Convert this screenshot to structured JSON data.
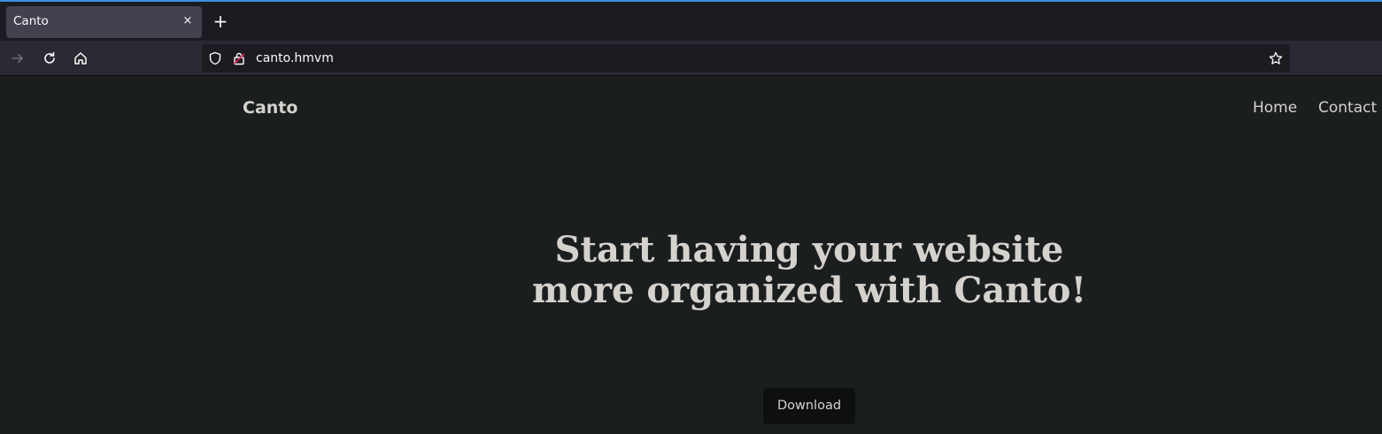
{
  "browser": {
    "tab_title": "Canto",
    "tab_close_glyph": "×",
    "new_tab_glyph": "+",
    "url": "canto.hmvm",
    "accent_color": "#3d8fe0"
  },
  "site": {
    "brand": "Canto",
    "nav": [
      {
        "label": "Home"
      },
      {
        "label": "Contact"
      }
    ],
    "hero_heading": "Start having your website more organized with Canto!",
    "download_label": "Download",
    "text_color": "#d5d2cd",
    "background_color": "#1b1e1f"
  }
}
